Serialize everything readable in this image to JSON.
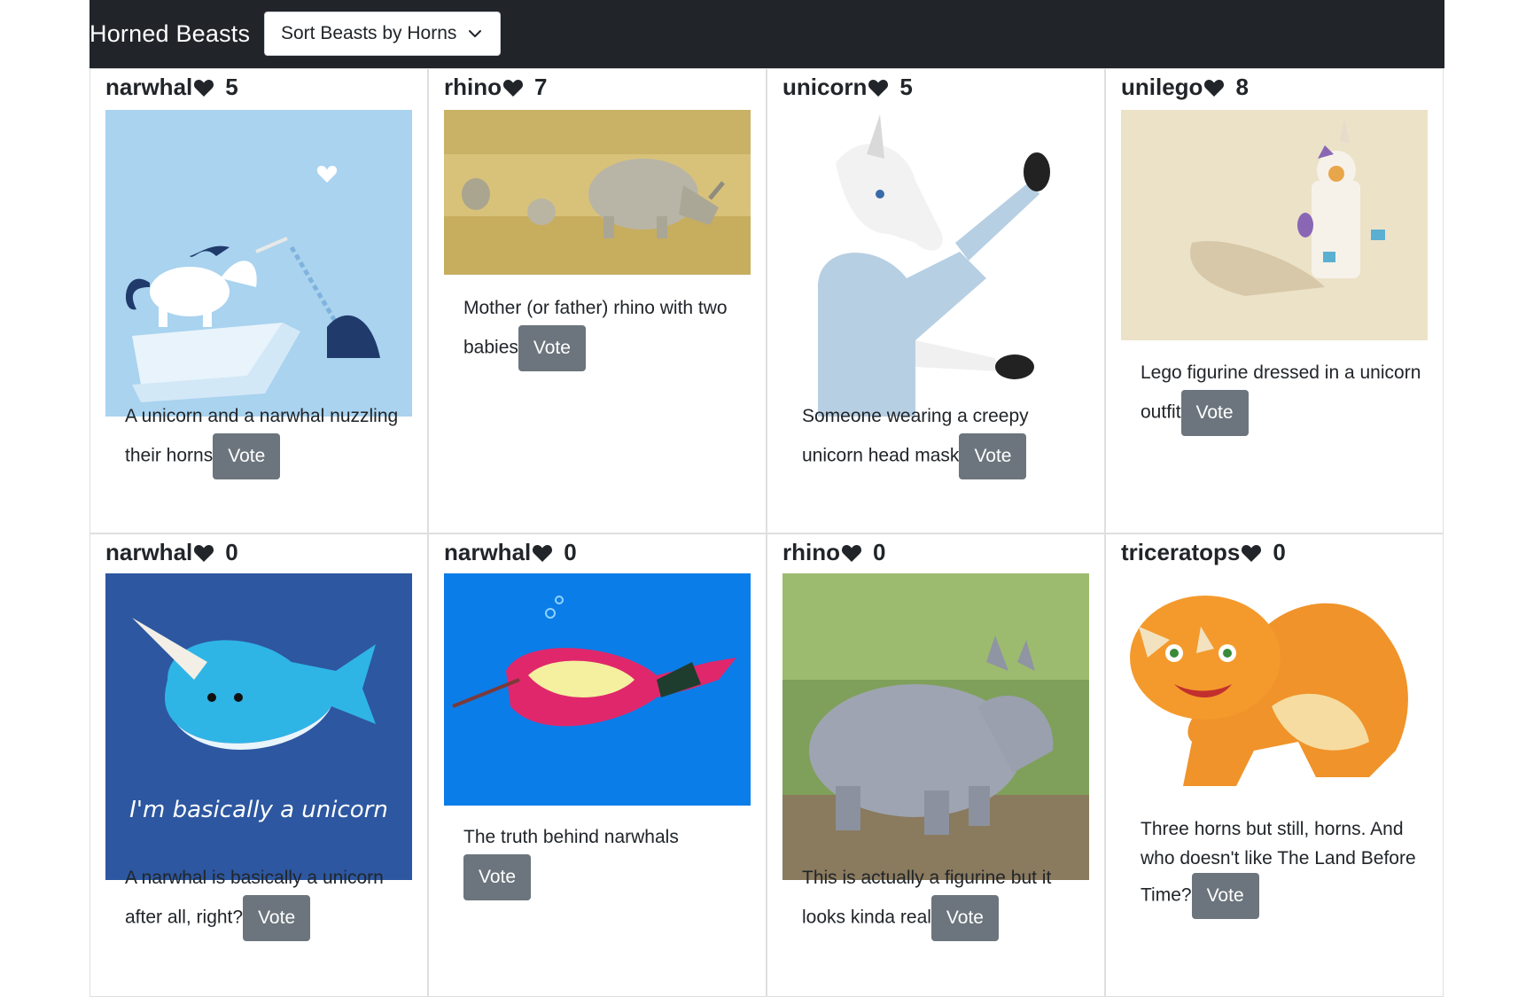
{
  "app": {
    "brand": "Horned Beasts",
    "sort_label": "Sort Beasts by Horns"
  },
  "beasts": [
    {
      "name": "narwhal",
      "votes": "5",
      "description": "A unicorn and a narwhal nuzzling their horns",
      "vote_label": "Vote",
      "image": "unicorn-narwhal-illustration"
    },
    {
      "name": "rhino",
      "votes": "7",
      "description": "Mother (or father) rhino with two babies",
      "vote_label": "Vote",
      "image": "rhino-family-photo"
    },
    {
      "name": "unicorn",
      "votes": "5",
      "description": "Someone wearing a creepy unicorn head mask",
      "vote_label": "Vote",
      "image": "unicorn-mask-photo"
    },
    {
      "name": "unilego",
      "votes": "8",
      "description": "Lego figurine dressed in a unicorn outfit",
      "vote_label": "Vote",
      "image": "lego-unicorn-photo"
    },
    {
      "name": "narwhal",
      "votes": "0",
      "description": "A narwhal is basically a unicorn after all, right?",
      "vote_label": "Vote",
      "image": "narwhal-cartoon",
      "image_caption": "I'm basically a unicorn"
    },
    {
      "name": "narwhal",
      "votes": "0",
      "description": "The truth behind narwhals",
      "vote_label": "Vote",
      "image": "narwhal-truth-drawing"
    },
    {
      "name": "rhino",
      "votes": "0",
      "description": "This is actually a figurine but it looks kinda real",
      "vote_label": "Vote",
      "image": "baby-rhino-figurine-photo"
    },
    {
      "name": "triceratops",
      "votes": "0",
      "description": "Three horns but still, horns. And who doesn't like The Land Before Time?",
      "vote_label": "Vote",
      "image": "triceratops-cartoon"
    }
  ],
  "colors": {
    "navbar": "#212529",
    "vote_button": "#6c757d"
  }
}
